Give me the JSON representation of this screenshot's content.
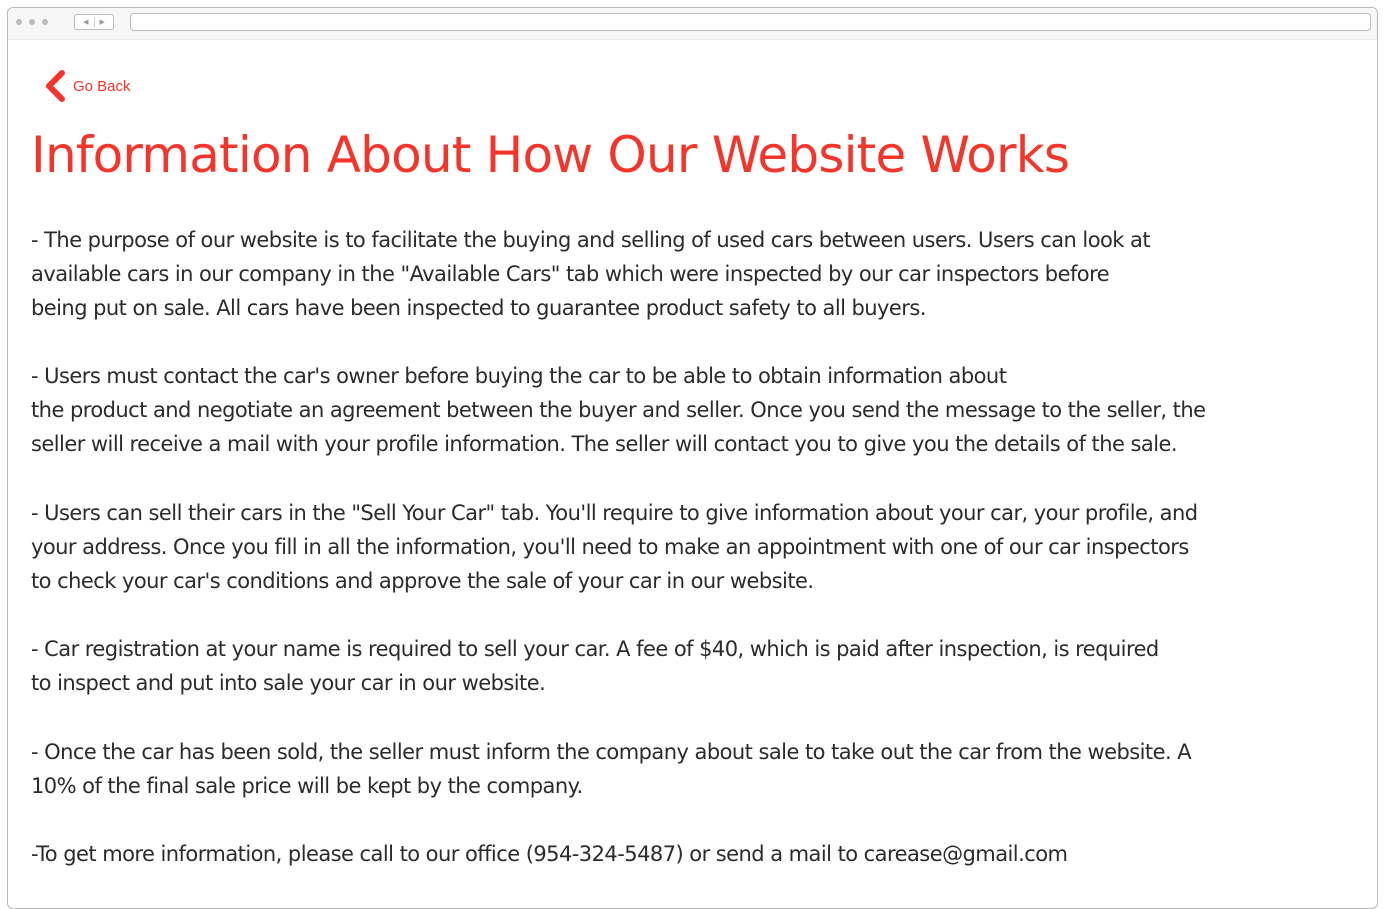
{
  "back_link": {
    "label": "Go Back",
    "icon": "chevron-left-icon",
    "color": "#f3352b"
  },
  "page_title": "Information About How Our Website Works",
  "accent_color": "#f3352b",
  "text_color": "#2b2b2b",
  "paragraphs": [
    {
      "lines": [
        "- The purpose of our website is to facilitate the buying and selling of used cars between users. Users can look at",
        "available cars in our company in the \"Available Cars\" tab which were inspected by our car inspectors before",
        "being put on sale. All cars have been inspected to guarantee product safety to all buyers."
      ]
    },
    {
      "lines": [
        "- Users must contact the car's owner before buying the car to be able to obtain information about",
        "the product and negotiate an agreement between the buyer and seller. Once you send the message to the seller, the",
        "seller will receive a mail with your profile information. The seller will contact you to give you the details of the sale."
      ]
    },
    {
      "lines": [
        "- Users can sell their cars in the \"Sell Your Car\" tab. You'll require to give information about your car, your profile, and",
        "your address. Once you fill in all the information, you'll need to make an appointment with one of our car inspectors",
        "to check your car's conditions and approve the sale of your car in our website."
      ]
    },
    {
      "lines": [
        "- Car registration at your name is required to sell your car. A fee of $40, which is paid after inspection, is required",
        "to inspect and put into sale your car in our website."
      ]
    },
    {
      "lines": [
        "- Once the car has been sold, the seller must inform the company about sale to take out the car from the website. A",
        "10% of the final sale price will be kept by the company."
      ]
    },
    {
      "lines": [
        "-To get more information, please call to our office (954-324-5487) or send a mail to carease@gmail.com"
      ]
    }
  ]
}
